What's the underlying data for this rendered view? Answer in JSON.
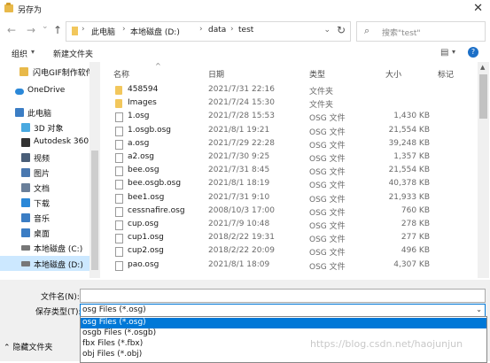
{
  "window": {
    "title": "另存为",
    "close_glyph": "✕"
  },
  "nav": {
    "back": "←",
    "forward": "→",
    "recent": "⌄",
    "up": "↑",
    "breadcrumbs": [
      "此电脑",
      "本地磁盘 (D:)",
      "data",
      "test"
    ],
    "separator": "›",
    "dropdown": "⌄",
    "refresh": "↻",
    "search_icon": "⌕",
    "search_placeholder": "搜索\"test\""
  },
  "toolbar": {
    "organize": "组织",
    "organize_caret": "▾",
    "new_folder": "新建文件夹",
    "view_icon": "▤",
    "view_caret": "▾",
    "help": "?"
  },
  "sidebar": {
    "items": [
      {
        "label": "闪电GIF制作软件",
        "icon": "folder-icon",
        "color": "#e8b94a"
      },
      {
        "label": "OneDrive",
        "icon": "cloud-icon",
        "color": "#2b88d8"
      },
      {
        "label": "此电脑",
        "icon": "computer-icon",
        "color": "#3b7dc4"
      },
      {
        "label": "3D 对象",
        "icon": "cube-icon",
        "color": "#49a9e0"
      },
      {
        "label": "Autodesk 360",
        "icon": "autodesk-icon",
        "color": "#333333"
      },
      {
        "label": "视频",
        "icon": "video-icon",
        "color": "#4a5e78"
      },
      {
        "label": "图片",
        "icon": "picture-icon",
        "color": "#4a78b0"
      },
      {
        "label": "文档",
        "icon": "document-icon",
        "color": "#6a7f9a"
      },
      {
        "label": "下载",
        "icon": "download-icon",
        "color": "#2b88d8"
      },
      {
        "label": "音乐",
        "icon": "music-icon",
        "color": "#3b7dc4"
      },
      {
        "label": "桌面",
        "icon": "desktop-icon",
        "color": "#3b7dc4"
      },
      {
        "label": "本地磁盘 (C:)",
        "icon": "drive-icon",
        "color": "#777777"
      },
      {
        "label": "本地磁盘 (D:)",
        "icon": "drive-icon",
        "color": "#777777"
      }
    ]
  },
  "filelist": {
    "sort_arrow": "^",
    "headers": {
      "name": "名称",
      "date": "日期",
      "type": "类型",
      "size": "大小",
      "tag": "标记"
    },
    "rows": [
      {
        "name": "458594",
        "date": "2021/7/31 22:16",
        "type": "文件夹",
        "size": "",
        "kind": "folder"
      },
      {
        "name": "Images",
        "date": "2021/7/24 15:30",
        "type": "文件夹",
        "size": "",
        "kind": "folder"
      },
      {
        "name": "1.osg",
        "date": "2021/7/28 15:53",
        "type": "OSG 文件",
        "size": "1,430 KB",
        "kind": "file"
      },
      {
        "name": "1.osgb.osg",
        "date": "2021/8/1 19:21",
        "type": "OSG 文件",
        "size": "21,554 KB",
        "kind": "file"
      },
      {
        "name": "a.osg",
        "date": "2021/7/29 22:28",
        "type": "OSG 文件",
        "size": "39,248 KB",
        "kind": "file"
      },
      {
        "name": "a2.osg",
        "date": "2021/7/30 9:25",
        "type": "OSG 文件",
        "size": "1,357 KB",
        "kind": "file"
      },
      {
        "name": "bee.osg",
        "date": "2021/7/31 8:45",
        "type": "OSG 文件",
        "size": "21,554 KB",
        "kind": "file"
      },
      {
        "name": "bee.osgb.osg",
        "date": "2021/8/1 18:19",
        "type": "OSG 文件",
        "size": "40,378 KB",
        "kind": "file"
      },
      {
        "name": "bee1.osg",
        "date": "2021/7/31 9:10",
        "type": "OSG 文件",
        "size": "21,933 KB",
        "kind": "file"
      },
      {
        "name": "cessnafire.osg",
        "date": "2008/10/3 17:00",
        "type": "OSG 文件",
        "size": "760 KB",
        "kind": "file"
      },
      {
        "name": "cup.osg",
        "date": "2021/7/9 10:48",
        "type": "OSG 文件",
        "size": "278 KB",
        "kind": "file"
      },
      {
        "name": "cup1.osg",
        "date": "2018/2/22 19:31",
        "type": "OSG 文件",
        "size": "277 KB",
        "kind": "file"
      },
      {
        "name": "cup2.osg",
        "date": "2018/2/22 20:09",
        "type": "OSG 文件",
        "size": "496 KB",
        "kind": "file"
      },
      {
        "name": "pao.osg",
        "date": "2021/8/1 18:09",
        "type": "OSG 文件",
        "size": "4,307 KB",
        "kind": "file"
      }
    ],
    "scroll_up": "▲"
  },
  "form": {
    "filename_label": "文件名(N):",
    "filename_value": "",
    "filetype_label": "保存类型(T):",
    "filetype_value": "osg Files (*.osg)",
    "caret": "⌄",
    "options": [
      "osg Files (*.osg)",
      "osgb Files (*.osgb)",
      "fbx Files (*.fbx)",
      "obj Files (*.obj)"
    ],
    "hide_folders": "⌃ 隐藏文件夹"
  },
  "watermark": "https://blog.csdn.net/haojunjun"
}
